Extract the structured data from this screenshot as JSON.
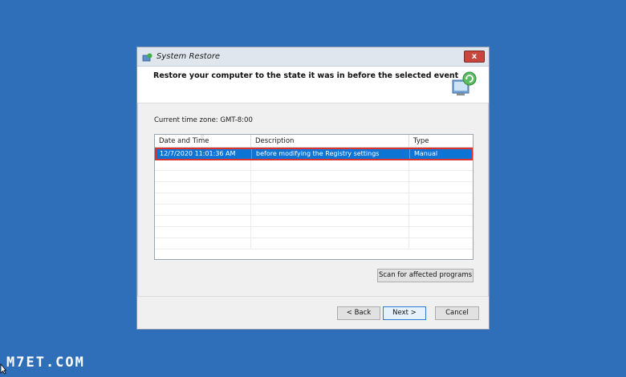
{
  "window": {
    "title": "System Restore",
    "close_label": "x"
  },
  "header": {
    "text": "Restore your computer to the state it was in before the selected event"
  },
  "timezone": "Current time zone: GMT-8:00",
  "table": {
    "columns": [
      "Date and Time",
      "Description",
      "Type"
    ],
    "rows": [
      {
        "date": "12/7/2020 11:01:36 AM",
        "description": "before modifying the Registry settings",
        "type": "Manual"
      }
    ]
  },
  "buttons": {
    "scan": "Scan for affected programs",
    "back": "< Back",
    "next": "Next >",
    "cancel": "Cancel"
  },
  "watermark": "M7ET.COM",
  "colors": {
    "desktop": "#2f6fb9",
    "selection": "#0e74d6",
    "highlight_outline": "#d9342b"
  },
  "icons": [
    "system-restore-icon",
    "restore-computer-icon",
    "close-icon",
    "sort-arrow-icon",
    "mouse-cursor-icon"
  ]
}
